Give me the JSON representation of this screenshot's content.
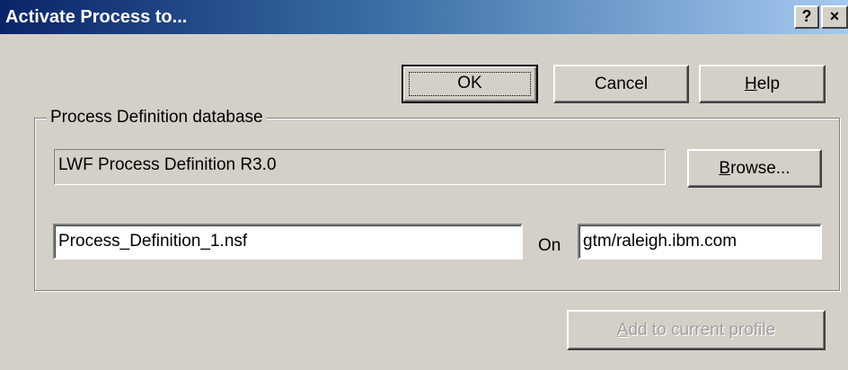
{
  "window": {
    "title": "Activate Process to...",
    "help_button": "?",
    "close_button": "×"
  },
  "buttons": {
    "ok": "OK",
    "cancel": "Cancel",
    "help": "Help",
    "help_mnemonic": "H",
    "help_rest": "elp",
    "browse_mnemonic": "B",
    "browse_rest": "rowse...",
    "add_profile_mnemonic": "A",
    "add_profile_rest": "dd to current profile"
  },
  "group": {
    "label": "Process Definition database",
    "template_name": "LWF Process Definition R3.0",
    "filename_value": "Process_Definition_1.nsf",
    "on_label": "On",
    "server_value": "gtm/raleigh.ibm.com"
  },
  "colors": {
    "dialog_bg": "#d4d0c8",
    "title_gradient_start": "#0a246a",
    "title_gradient_end": "#a6caf0",
    "title_text": "#ffffff",
    "disabled_text": "#a0a0a0"
  },
  "icons": {
    "help": "question-mark",
    "close": "close-x"
  }
}
